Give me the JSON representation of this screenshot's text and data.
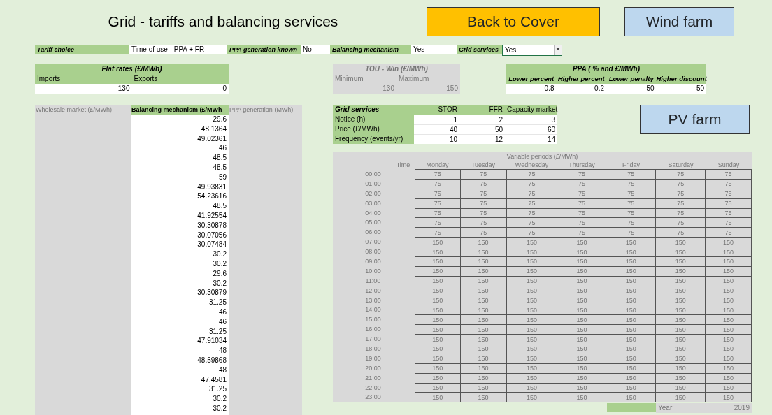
{
  "title": "Grid - tariffs and balancing services",
  "nav_buttons": [
    {
      "label": "Back to Cover",
      "color": "#ffc000"
    },
    {
      "label": "Wind farm",
      "color": "#bdd7ee"
    }
  ],
  "settings": [
    {
      "label": "Tariff choice",
      "value": "Time of use - PPA + FR",
      "kind": "cell"
    },
    {
      "label": "PPA generation known",
      "value": "No",
      "kind": "cell"
    },
    {
      "label": "Balancing mechanism",
      "value": "Yes",
      "kind": "cell"
    },
    {
      "label": "Grid services",
      "value": "Yes",
      "kind": "dropdown"
    }
  ],
  "flat_rates": {
    "title": "Flat rates (£/MWh)",
    "columns": [
      "Imports",
      "Exports"
    ],
    "values": [
      "130",
      "0"
    ],
    "disabled": false
  },
  "tou_rates": {
    "title": "TOU - Win (£/MWh)",
    "columns": [
      "Minimum",
      "Maximum"
    ],
    "values": [
      "130",
      "150"
    ],
    "disabled": true
  },
  "ppa": {
    "title": "PPA ( % and £/MWh)",
    "columns": [
      "Lower percent",
      "Higher percent",
      "Lower penalty",
      "Higher discount"
    ],
    "values": [
      "0.8",
      "0.2",
      "50",
      "50"
    ]
  },
  "price_table": {
    "columns": [
      {
        "label": "Wholesale market (£/MWh)",
        "disabled": true
      },
      {
        "label": "Balancing mechanism (£/MWh",
        "disabled": false
      },
      {
        "label": "PPA generation (MWh)",
        "disabled": true
      }
    ],
    "balancing_values": [
      "29.6",
      "48.1364",
      "49.02361",
      "46",
      "48.5",
      "48.5",
      "59",
      "49.93831",
      "54.23616",
      "48.5",
      "41.92554",
      "30.30878",
      "30.07056",
      "30.07484",
      "30.2",
      "30.2",
      "29.6",
      "30.2",
      "30.30879",
      "31.25",
      "46",
      "46",
      "31.25",
      "47.91034",
      "48",
      "48.59868",
      "48",
      "47.4581",
      "31.25",
      "30.2",
      "30.2"
    ]
  },
  "grid_services": {
    "columns": [
      "Grid services",
      "STOR",
      "FFR",
      "Capacity market"
    ],
    "rows": [
      {
        "label": "Notice (h)",
        "values": [
          "1",
          "2",
          "3"
        ]
      },
      {
        "label": "Price (£/MWh)",
        "values": [
          "40",
          "50",
          "60"
        ]
      },
      {
        "label": "Frequency (events/yr)",
        "values": [
          "10",
          "12",
          "14"
        ]
      }
    ]
  },
  "pv_button": {
    "label": "PV farm",
    "color": "#bdd7ee"
  },
  "variable_periods": {
    "title": "Variable periods (£/MWh)",
    "disabled": true,
    "columns": [
      "Time",
      "Monday",
      "Tuesday",
      "Wednesday",
      "Thursday",
      "Friday",
      "Saturday",
      "Sunday"
    ],
    "rows": [
      {
        "time": "00:00",
        "values": [
          "75",
          "75",
          "75",
          "75",
          "75",
          "75",
          "75"
        ]
      },
      {
        "time": "01:00",
        "values": [
          "75",
          "75",
          "75",
          "75",
          "75",
          "75",
          "75"
        ]
      },
      {
        "time": "02:00",
        "values": [
          "75",
          "75",
          "75",
          "75",
          "75",
          "75",
          "75"
        ]
      },
      {
        "time": "03:00",
        "values": [
          "75",
          "75",
          "75",
          "75",
          "75",
          "75",
          "75"
        ]
      },
      {
        "time": "04:00",
        "values": [
          "75",
          "75",
          "75",
          "75",
          "75",
          "75",
          "75"
        ]
      },
      {
        "time": "05:00",
        "values": [
          "75",
          "75",
          "75",
          "75",
          "75",
          "75",
          "75"
        ]
      },
      {
        "time": "06:00",
        "values": [
          "75",
          "75",
          "75",
          "75",
          "75",
          "75",
          "75"
        ]
      },
      {
        "time": "07:00",
        "values": [
          "150",
          "150",
          "150",
          "150",
          "150",
          "150",
          "150"
        ]
      },
      {
        "time": "08:00",
        "values": [
          "150",
          "150",
          "150",
          "150",
          "150",
          "150",
          "150"
        ]
      },
      {
        "time": "09:00",
        "values": [
          "150",
          "150",
          "150",
          "150",
          "150",
          "150",
          "150"
        ]
      },
      {
        "time": "10:00",
        "values": [
          "150",
          "150",
          "150",
          "150",
          "150",
          "150",
          "150"
        ]
      },
      {
        "time": "11:00",
        "values": [
          "150",
          "150",
          "150",
          "150",
          "150",
          "150",
          "150"
        ]
      },
      {
        "time": "12:00",
        "values": [
          "150",
          "150",
          "150",
          "150",
          "150",
          "150",
          "150"
        ]
      },
      {
        "time": "13:00",
        "values": [
          "150",
          "150",
          "150",
          "150",
          "150",
          "150",
          "150"
        ]
      },
      {
        "time": "14:00",
        "values": [
          "150",
          "150",
          "150",
          "150",
          "150",
          "150",
          "150"
        ]
      },
      {
        "time": "15:00",
        "values": [
          "150",
          "150",
          "150",
          "150",
          "150",
          "150",
          "150"
        ]
      },
      {
        "time": "16:00",
        "values": [
          "150",
          "150",
          "150",
          "150",
          "150",
          "150",
          "150"
        ]
      },
      {
        "time": "17:00",
        "values": [
          "150",
          "150",
          "150",
          "150",
          "150",
          "150",
          "150"
        ]
      },
      {
        "time": "18:00",
        "values": [
          "150",
          "150",
          "150",
          "150",
          "150",
          "150",
          "150"
        ]
      },
      {
        "time": "19:00",
        "values": [
          "150",
          "150",
          "150",
          "150",
          "150",
          "150",
          "150"
        ]
      },
      {
        "time": "20:00",
        "values": [
          "150",
          "150",
          "150",
          "150",
          "150",
          "150",
          "150"
        ]
      },
      {
        "time": "21:00",
        "values": [
          "150",
          "150",
          "150",
          "150",
          "150",
          "150",
          "150"
        ]
      },
      {
        "time": "22:00",
        "values": [
          "150",
          "150",
          "150",
          "150",
          "150",
          "150",
          "150"
        ]
      },
      {
        "time": "23:00",
        "values": [
          "150",
          "150",
          "150",
          "150",
          "150",
          "150",
          "150"
        ]
      }
    ],
    "footer": {
      "label": "Year",
      "value": "2019"
    }
  }
}
